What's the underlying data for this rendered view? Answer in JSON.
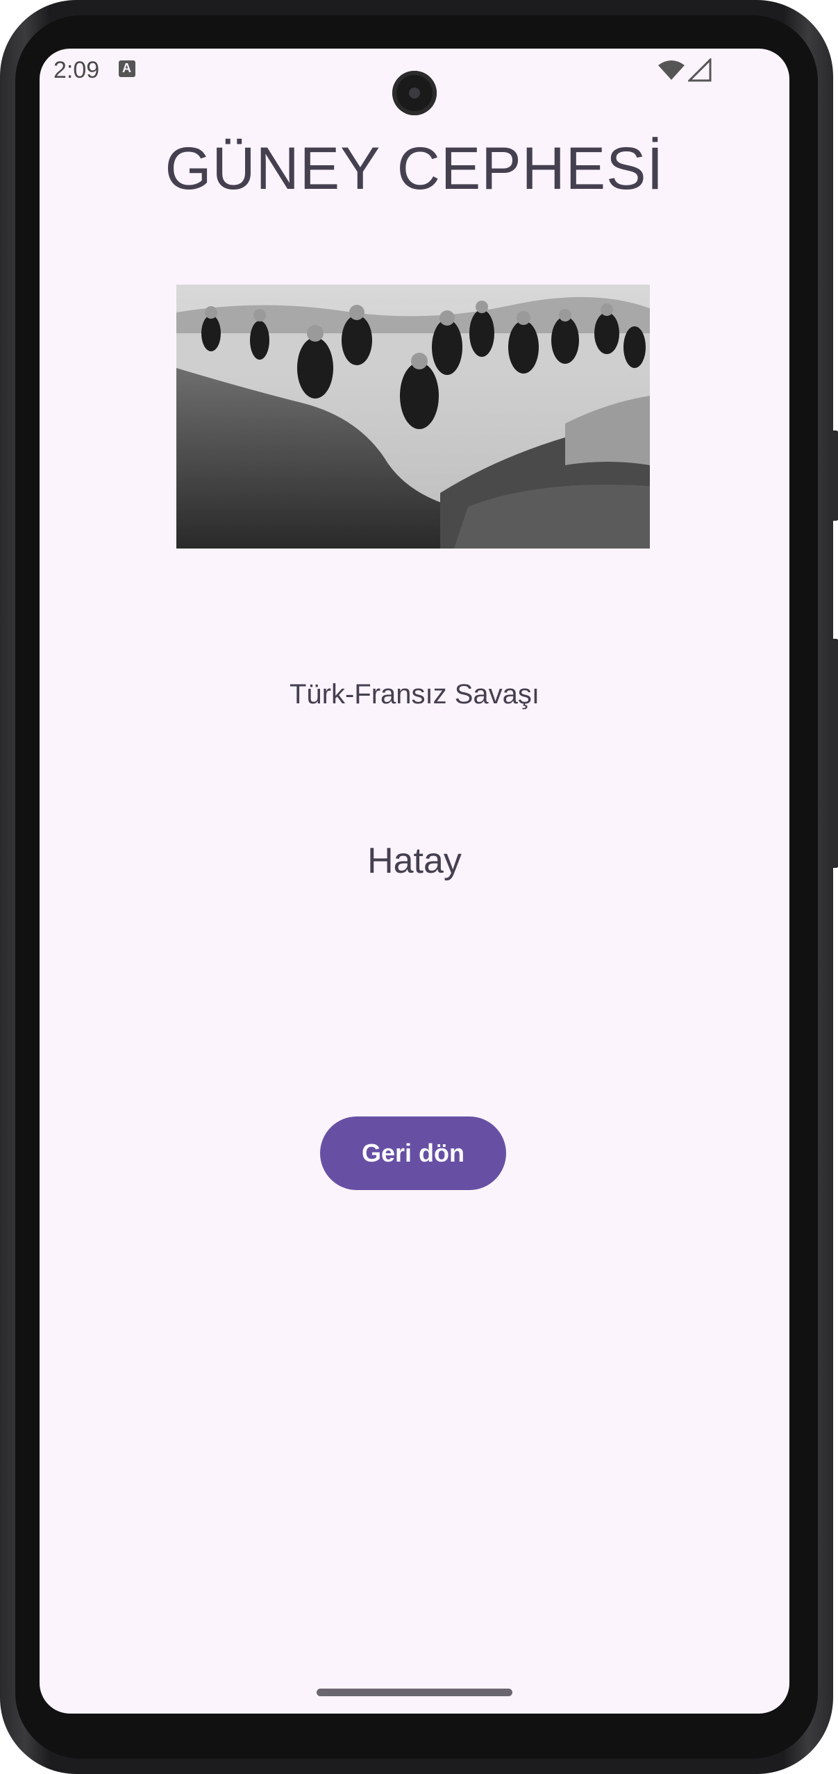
{
  "status_bar": {
    "time": "2:09",
    "icons": [
      "a-notification-icon",
      "wifi-icon",
      "cell-signal-icon"
    ]
  },
  "page": {
    "title": "GÜNEY CEPHESİ",
    "image_alt": "WWI trench soldiers photo",
    "subtitle": "Türk-Fransız Savaşı",
    "location": "Hatay",
    "back_button_label": "Geri dön"
  },
  "colors": {
    "background": "#fcf4fc",
    "text": "#454050",
    "button": "#6750a4",
    "button_text": "#ffffff"
  }
}
